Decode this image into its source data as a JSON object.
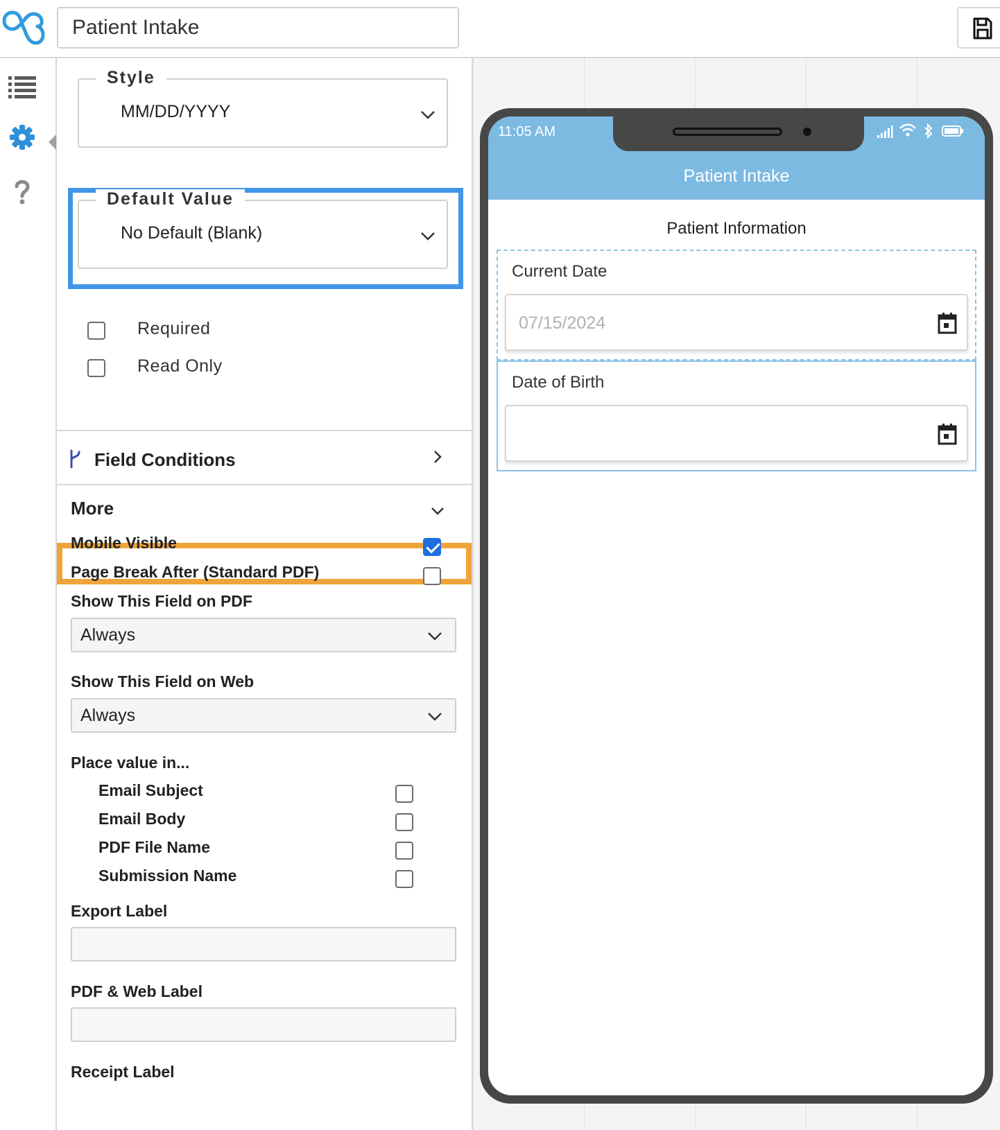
{
  "header": {
    "form_title": "Patient Intake"
  },
  "panel": {
    "style": {
      "legend": "Style",
      "value": "MM/DD/YYYY"
    },
    "default_value": {
      "legend": "Default Value",
      "value": "No Default (Blank)"
    },
    "options": [
      {
        "label": "Required",
        "checked": false
      },
      {
        "label": "Read Only",
        "checked": false
      }
    ],
    "field_conditions": "Field Conditions",
    "more": "More",
    "mobile_visible": {
      "label": "Mobile Visible",
      "checked": true
    },
    "page_break": {
      "label": "Page Break After (Standard PDF)",
      "checked": false
    },
    "show_pdf": {
      "label": "Show This Field on PDF",
      "value": "Always"
    },
    "show_web": {
      "label": "Show This Field on Web",
      "value": "Always"
    },
    "place_value": {
      "label": "Place value in...",
      "items": [
        "Email Subject",
        "Email Body",
        "PDF File Name",
        "Submission Name"
      ]
    },
    "export_label": {
      "label": "Export Label",
      "value": ""
    },
    "pdf_web_label": {
      "label": "PDF & Web Label",
      "value": ""
    },
    "receipt_label": {
      "label": "Receipt Label"
    }
  },
  "preview": {
    "status_time": "11:05 AM",
    "app_title": "Patient Intake",
    "section_heading": "Patient Information",
    "fields": [
      {
        "label": "Current Date",
        "value": "07/15/2024"
      },
      {
        "label": "Date of Birth",
        "value": ""
      }
    ]
  },
  "colors": {
    "accent_blue": "#4096e8",
    "highlight_orange": "#efa43a",
    "app_bar": "#7cbae2",
    "checkbox_checked": "#1e6fe0"
  }
}
